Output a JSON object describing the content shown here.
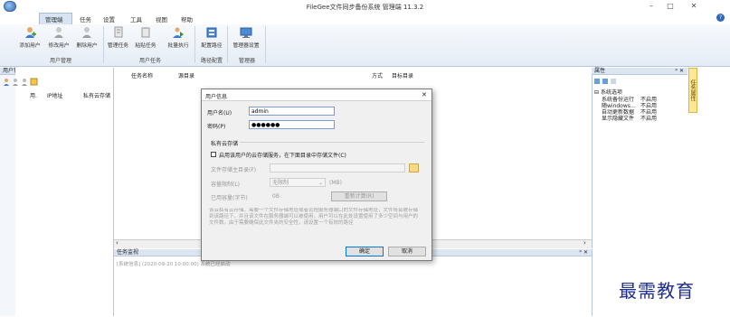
{
  "window": {
    "title": "FileGee文件同步备份系统 管理端 11.3.2",
    "minimize": "–",
    "maximize": "□",
    "close": "✕"
  },
  "menu": {
    "items": [
      "管理端",
      "任务",
      "设置",
      "工具",
      "视图",
      "帮助"
    ],
    "help_glyph": "?"
  },
  "ribbon": {
    "buttons": [
      {
        "label": "添加用户",
        "icon": "add-user-icon"
      },
      {
        "label": "修改用户",
        "icon": "edit-user-icon"
      },
      {
        "label": "删除用户",
        "icon": "delete-user-icon"
      },
      {
        "label": "管理任务",
        "icon": "manage-task-icon"
      },
      {
        "label": "粘贴任务",
        "icon": "paste-task-icon"
      },
      {
        "label": "批量执行",
        "icon": "batch-run-icon"
      },
      {
        "label": "配置路径",
        "icon": "config-path-icon"
      },
      {
        "label": "管理器设置",
        "icon": "manager-settings-icon"
      }
    ],
    "groups": [
      "用户管理",
      "用户任务",
      "路径配置",
      "管理器"
    ]
  },
  "left_panel": {
    "title": "用户管理",
    "pin": "ᵖ ✕",
    "columns": [
      "用.",
      "IP地址",
      "私有云存储"
    ]
  },
  "center": {
    "columns": [
      "任务名称",
      "源目录",
      "方式",
      "目标目录"
    ]
  },
  "right_panel": {
    "title": "属性",
    "pin": "ᵖ ✕",
    "side_tab": "任务属性",
    "section": "系统选项",
    "props": [
      {
        "name": "系统备份运行",
        "value": "不启用"
      },
      {
        "name": "随windows…",
        "value": "不启用"
      },
      {
        "name": "自动更新数据",
        "value": "不启用"
      },
      {
        "name": "显示隐藏文件",
        "value": "不启用"
      }
    ]
  },
  "task_monitor": {
    "title": "任务监视",
    "pin": "ᵖ ✕",
    "log_line": "[系统信息] (2020-09-20 10:00:00) 系统已经启动"
  },
  "dialog": {
    "title": "用户信息",
    "close": "✕",
    "username_label": "用户名(U)",
    "username_value": "admin",
    "password_label": "密码(P)",
    "password_value": "●●●●●●",
    "section_title": "私有云存储",
    "checkbox_label": "启用该用户的云存储服务，在下面目录中存储文件(C)",
    "dir_label": "文件存储主目录(F)",
    "quota_label": "容量限制(L)",
    "quota_value": "无限制",
    "quota_unit": "(MB)",
    "used_label": "已用容量(字节)",
    "used_value": "0B",
    "calc_button": "重新计算(R)",
    "note": "该云私有云存储，需要一个文件存储地址或者远程服务器端口的文件存储地址，文件将会被存储到该路径下，并且该文件在服务器端可以被使用，用户可以在此处设置使用了多少空间与用户的文件数。由于需要确保此文件夹的安全性，请设置一个有效的路径",
    "ok": "确定",
    "cancel": "取消"
  },
  "watermark": "最需教育"
}
